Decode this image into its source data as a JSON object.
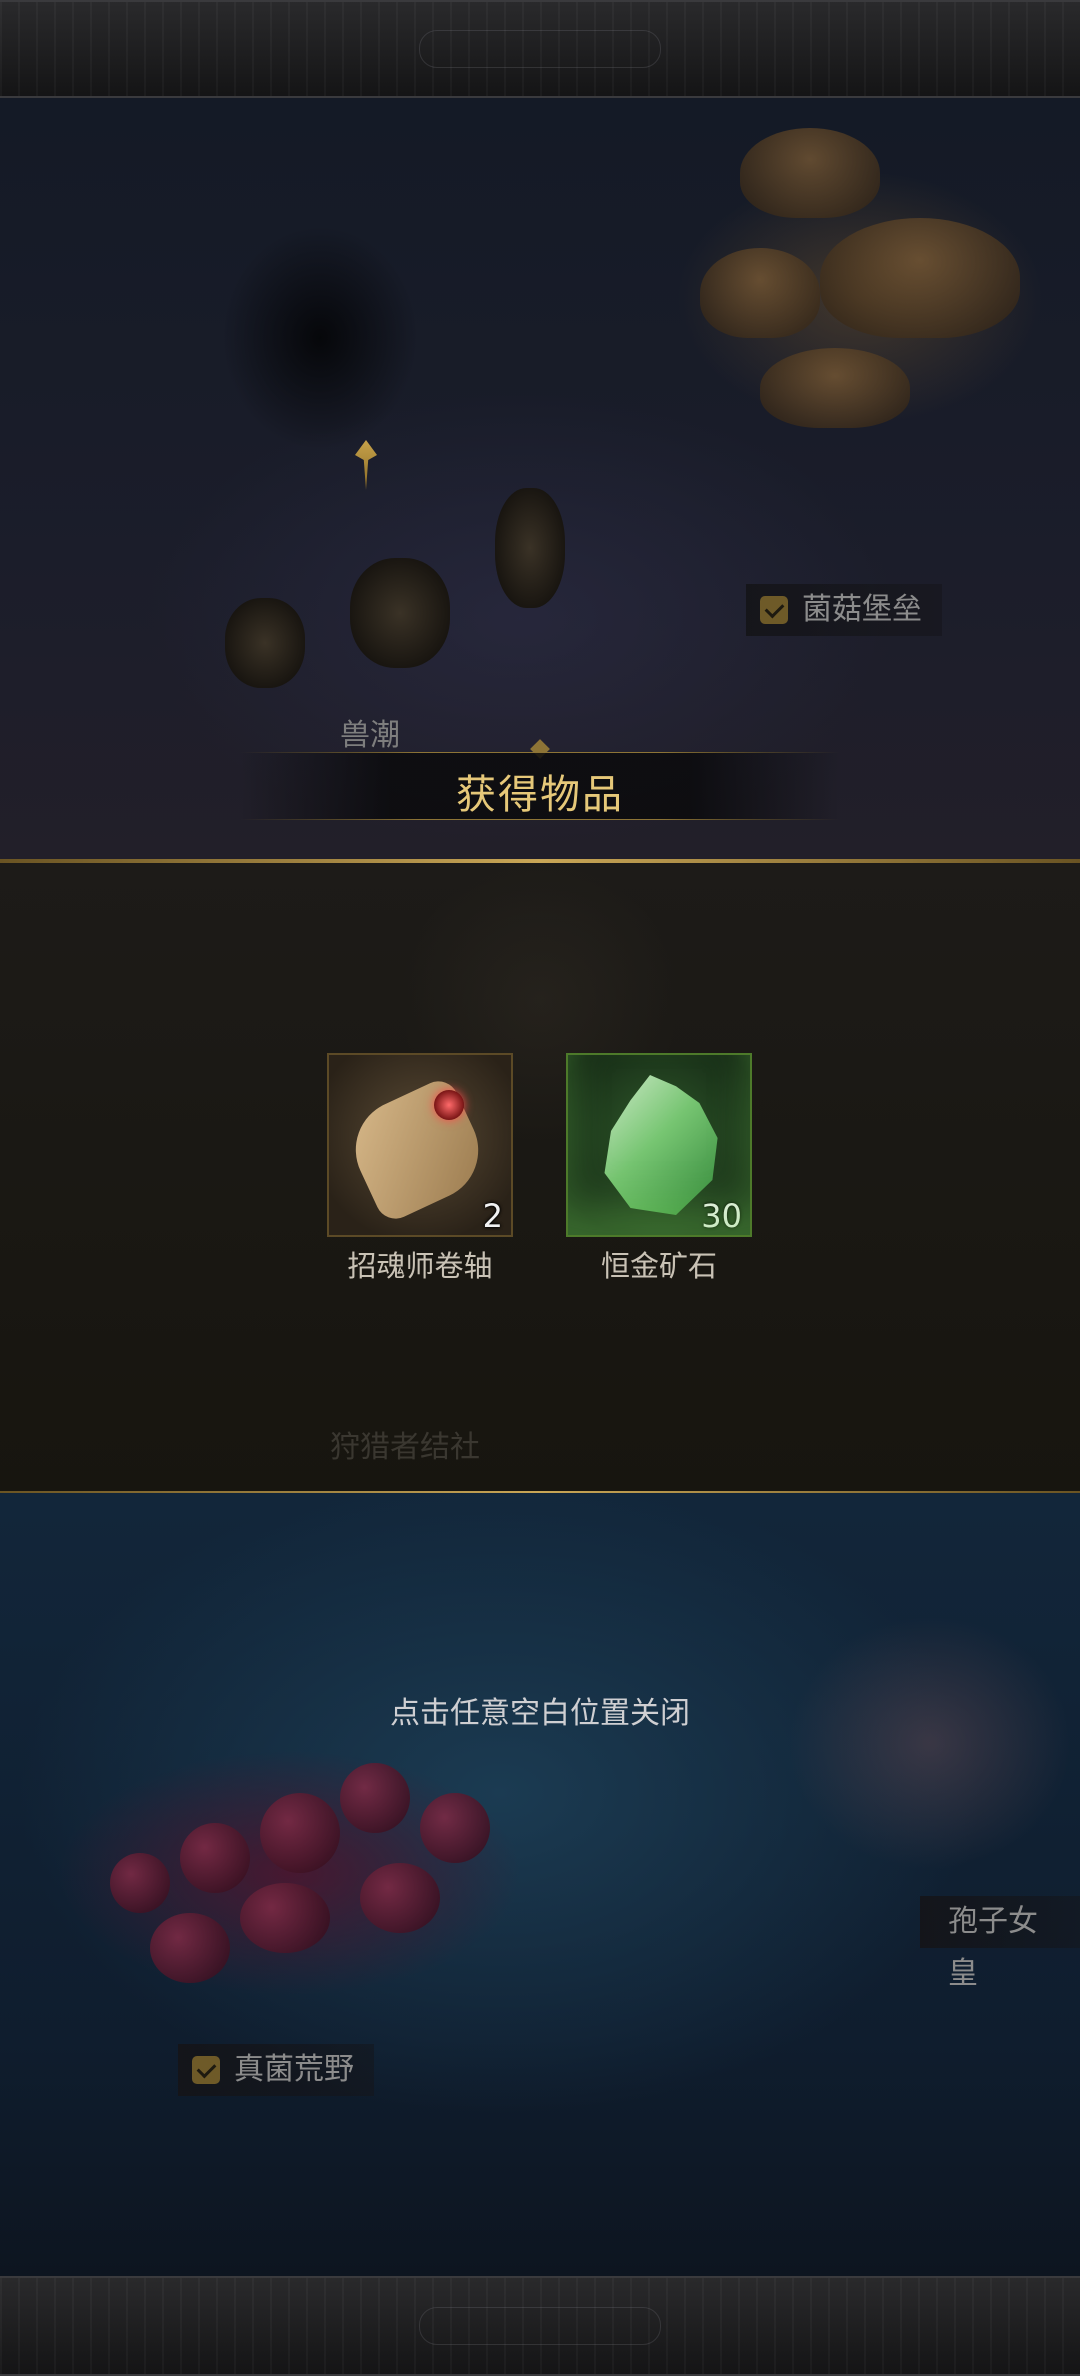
{
  "map": {
    "labels": {
      "mushroom_fortress": "菌菇堡垒",
      "beast_tide": "兽潮",
      "hunters_guild": "狩猎者结社",
      "spore_queen": "孢子女皇",
      "fungal_wilds": "真菌荒野"
    }
  },
  "reward_popup": {
    "title": "获得物品",
    "items": [
      {
        "name": "招魂师卷轴",
        "count": "2",
        "icon": "scroll-icon",
        "rarity_color": "#8a6a32"
      },
      {
        "name": "恒金矿石",
        "count": "30",
        "icon": "ore-crystal-icon",
        "rarity_color": "#4d7a2a"
      }
    ],
    "close_hint": "点击任意空白位置关闭"
  },
  "colors": {
    "accent_gold": "#c9a656",
    "title_gold": "#e6c879"
  }
}
